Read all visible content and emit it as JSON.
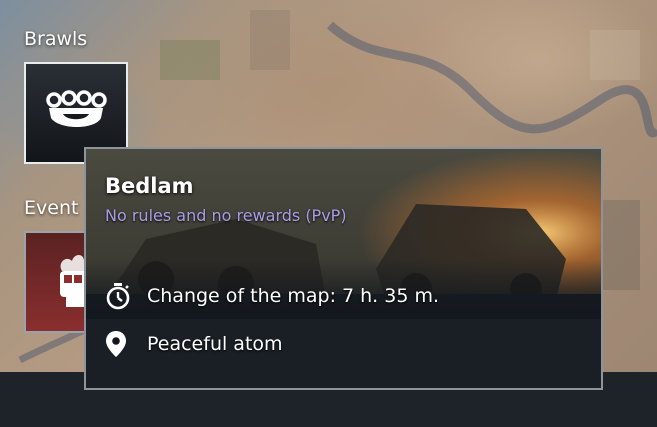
{
  "sections": {
    "brawls_label": "Brawls",
    "events_label": "Event"
  },
  "tooltip": {
    "title": "Bedlam",
    "subtitle": "No rules and no rewards (PvP)",
    "map_change": "Change of the map: 7 h. 35 m.",
    "location": "Peaceful atom"
  },
  "icons": {
    "brawls_tile": "brass-knuckles-icon",
    "events_tile": "flaming-fist-icon",
    "timer": "stopwatch-icon",
    "location": "map-pin-icon"
  },
  "colors": {
    "subtitle": "#a89ee8",
    "tooltip_bg": "#12171d",
    "tooltip_border": "#8d949b",
    "tile_border": "#e8ecef"
  }
}
